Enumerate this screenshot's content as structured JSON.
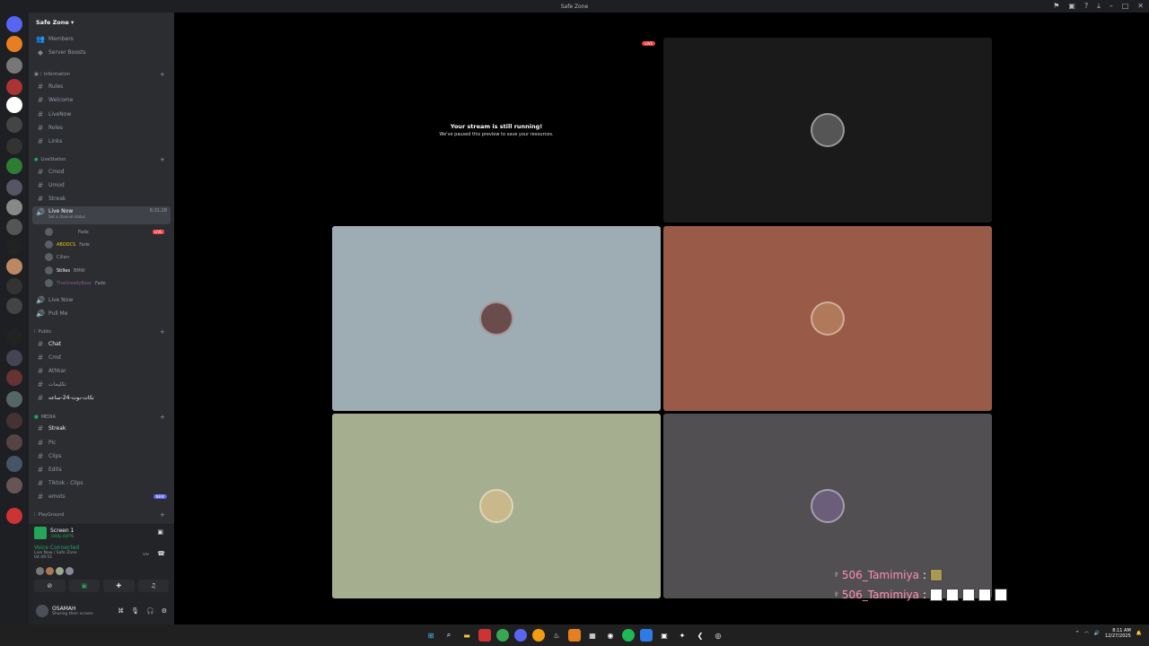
{
  "title": "Safe Zone",
  "server": {
    "name": "Safe Zone",
    "members": "Members",
    "boosts": "Server Boosts"
  },
  "categories": [
    "Information",
    "LiveStation",
    "Public",
    "MEDIA",
    "PlayGround"
  ],
  "info_channels": [
    "Rules",
    "Welcome",
    "LiveNow",
    "Roles",
    "Links"
  ],
  "live_channels": [
    "Cmod",
    "Umod",
    "Streak"
  ],
  "active_voice": {
    "name": "Live Now",
    "time": "8:31:28",
    "status": "Set a channel status"
  },
  "voice_users": [
    {
      "name": "",
      "tag": "Fade"
    },
    {
      "name": "ABODCS",
      "tag": "Fade"
    },
    {
      "name": "Cillan",
      "tag": ""
    },
    {
      "name": "Stilles",
      "tag": "BMW"
    },
    {
      "name": "TheGreedyBear",
      "tag": "Fade"
    }
  ],
  "live_badge": "LIVE",
  "voice_more": [
    "Live Now",
    "Pull Me"
  ],
  "public_channels": [
    "Chat",
    "Cmd",
    "Athkar",
    "تكليمات",
    "نكات-بوت-24-ساعه"
  ],
  "media_channels": [
    "Streak",
    "Pic",
    "Clips",
    "Edits",
    "Tiktok - Clips",
    "emots"
  ],
  "new_badge": "NEW",
  "stream": {
    "title": "Screen 1",
    "sub": "1080p 60FPS"
  },
  "voice": {
    "status": "Voice Connected",
    "path": "Live Now / Safe Zone",
    "time": "04:49:51"
  },
  "user": {
    "name": "OSAMAH",
    "status": "Sharing their screen"
  },
  "paused": {
    "title": "Your stream is still running!",
    "sub": "We've paused this preview to save your resources."
  },
  "chat": [
    {
      "user": "506_Tamimiya"
    },
    {
      "user": "506_Tamimiya"
    }
  ],
  "clock": {
    "time": "8:11 AM",
    "date": "12/27/2025"
  },
  "colors": {
    "tile1": "#9eacb4",
    "tile2": "#9a5a48",
    "tile3": "#a6ae90",
    "tile4": "#524f52",
    "tile0": "#1a1a1a"
  }
}
